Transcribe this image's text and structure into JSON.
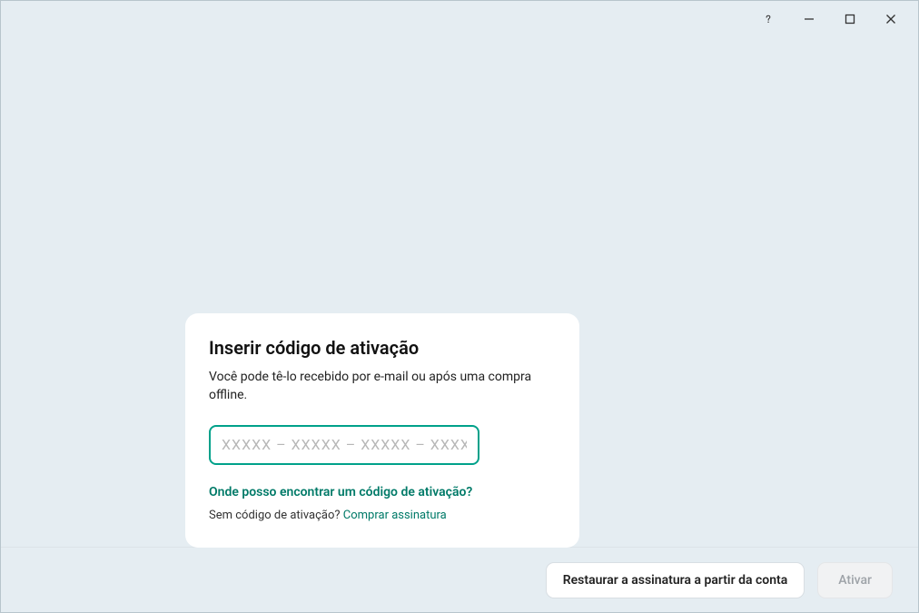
{
  "card": {
    "title": "Inserir código de ativação",
    "subtitle": "Você pode tê-lo recebido por e-mail ou após uma compra offline.",
    "input_placeholder": "ХХХХХ – ХХХХХ – ХХХХХ – ХХХХХ",
    "input_value": "",
    "help_link": "Onde posso encontrar um código de ativação?",
    "no_code_text": "Sem código de ativação? ",
    "buy_link": "Comprar assinatura"
  },
  "footer": {
    "restore_label": "Restaurar a assinatura a partir da conta",
    "activate_label": "Ativar"
  }
}
